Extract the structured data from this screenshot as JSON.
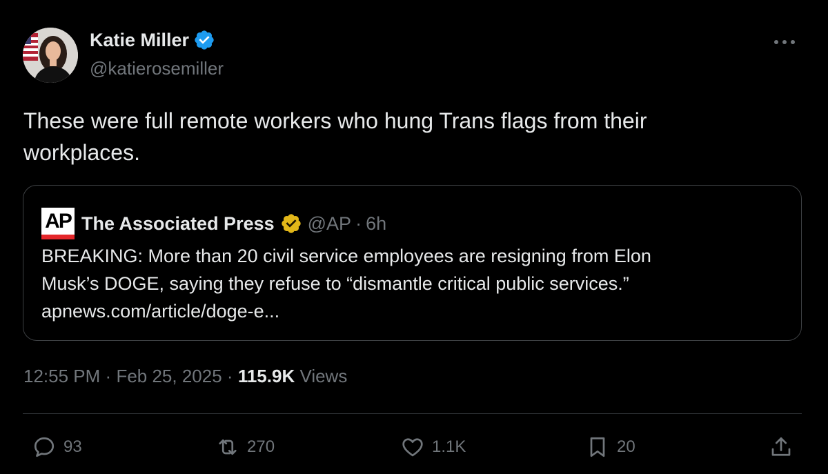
{
  "author": {
    "name": "Katie Miller",
    "handle": "@katierosemiller",
    "verified_icon": "blue-verified-badge",
    "avatar_icon": "profile-photo"
  },
  "tweet": {
    "text_line1": "These were full remote workers who hung Trans flags from their",
    "text_line2": "workplaces."
  },
  "quote": {
    "logo_text": "AP",
    "name": "The Associated Press",
    "verified_icon": "gold-verified-badge",
    "handle": "@AP",
    "separator": "·",
    "time": "6h",
    "line1": "BREAKING: More than 20 civil service employees are resigning from Elon",
    "line2": "Musk’s DOGE, saying they refuse to “dismantle critical public services.”",
    "line3": "apnews.com/article/doge-e..."
  },
  "meta": {
    "time": "12:55 PM",
    "sep1": "·",
    "date": "Feb 25, 2025",
    "sep2": "·",
    "views_count": "115.9K",
    "views_label": "Views"
  },
  "actions": {
    "replies": "93",
    "reposts": "270",
    "likes": "1.1K",
    "bookmarks": "20"
  },
  "colors": {
    "background": "#000000",
    "text": "#e7e9ea",
    "muted": "#71767b",
    "verified_blue": "#1d9bf0",
    "verified_gold": "#e2b719",
    "border": "#2f3336"
  }
}
